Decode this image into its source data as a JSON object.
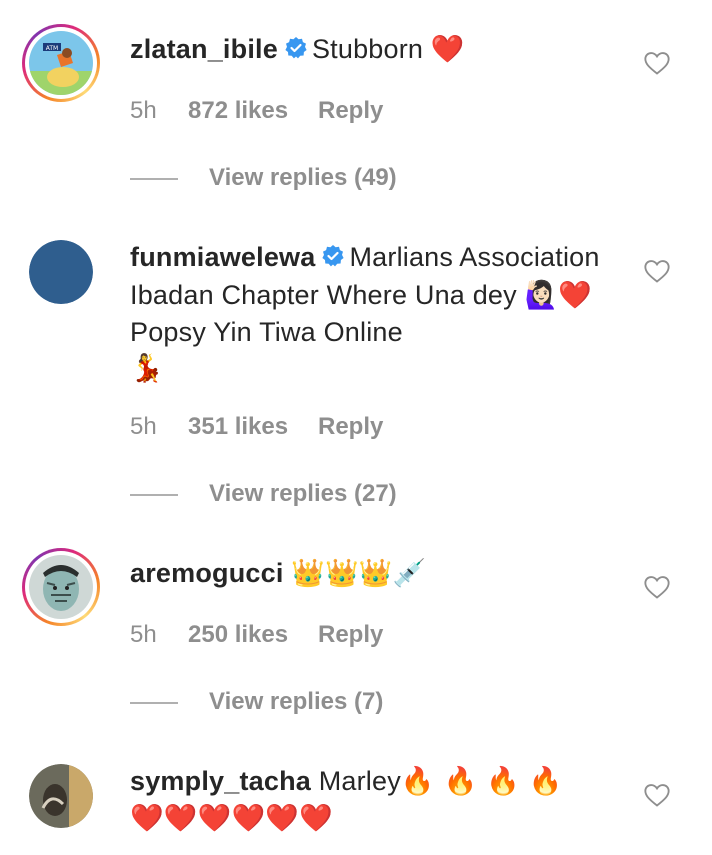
{
  "comments": [
    {
      "username": "zlatan_ibile",
      "verified": true,
      "text": "Stubborn",
      "emoji_suffix": "❤️",
      "time": "5h",
      "likes": "872 likes",
      "reply": "Reply",
      "view_replies": "View replies (49)",
      "avatar_icon": "cartoon-avatar",
      "has_story_ring": true
    },
    {
      "username": "funmiawelewa",
      "verified": true,
      "text_part1": "Marlians Association Ibadan Chapter Where Una dey",
      "emoji_mid": "🙋🏻‍♀️❤️",
      "text_part2": "Popsy Yin Tiwa Online",
      "emoji_suffix": "💃",
      "time": "5h",
      "likes": "351 likes",
      "reply": "Reply",
      "view_replies": "View replies (27)",
      "avatar_color": "#2f5e8e",
      "has_story_ring": false
    },
    {
      "username": "aremogucci",
      "verified": false,
      "text": "",
      "emoji_suffix": "👑👑👑💉",
      "time": "5h",
      "likes": "250 likes",
      "reply": "Reply",
      "view_replies": "View replies (7)",
      "avatar_icon": "tattooed-face-avatar",
      "has_story_ring": true
    },
    {
      "username": "symply_tacha",
      "verified": false,
      "text": "Marley",
      "emoji_inline": "🔥 🔥 🔥 🔥",
      "emoji_line2": "❤️❤️❤️❤️❤️❤️",
      "avatar_icon": "photo-avatar",
      "has_story_ring": false
    }
  ],
  "colors": {
    "verified_blue": "#3897f0",
    "secondary_text": "#8e8e8e",
    "primary_text": "#262626"
  }
}
